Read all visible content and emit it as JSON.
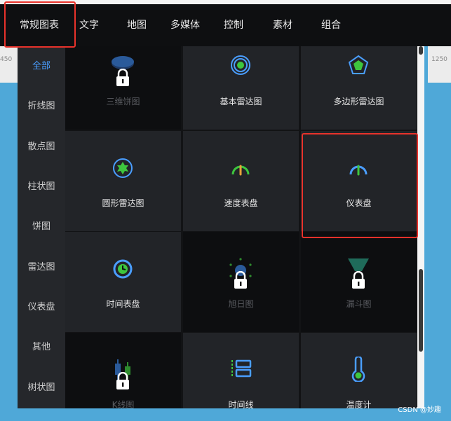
{
  "tabs": [
    {
      "label": "常规图表"
    },
    {
      "label": "文字"
    },
    {
      "label": "地图"
    },
    {
      "label": "多媒体"
    },
    {
      "label": "控制"
    },
    {
      "label": "素材"
    },
    {
      "label": "组合"
    }
  ],
  "ruler": {
    "left": "450",
    "right": "1250"
  },
  "sidebar": {
    "items": [
      {
        "label": "全部"
      },
      {
        "label": "折线图"
      },
      {
        "label": "散点图"
      },
      {
        "label": "柱状图"
      },
      {
        "label": "饼图"
      },
      {
        "label": "雷达图"
      },
      {
        "label": "仪表盘"
      },
      {
        "label": "其他"
      },
      {
        "label": "树状图"
      }
    ]
  },
  "cards": [
    {
      "label": "三维饼图",
      "icon": "pie-3d-icon",
      "locked": true
    },
    {
      "label": "基本雷达图",
      "icon": "radar-basic-icon",
      "locked": false
    },
    {
      "label": "多边形雷达图",
      "icon": "polygon-radar-icon",
      "locked": false
    },
    {
      "label": "圆形雷达图",
      "icon": "circle-radar-icon",
      "locked": false
    },
    {
      "label": "速度表盘",
      "icon": "speed-gauge-icon",
      "locked": false
    },
    {
      "label": "仪表盘",
      "icon": "gauge-icon",
      "locked": false
    },
    {
      "label": "时间表盘",
      "icon": "clock-gauge-icon",
      "locked": false
    },
    {
      "label": "旭日图",
      "icon": "sunburst-icon",
      "locked": true
    },
    {
      "label": "漏斗图",
      "icon": "funnel-icon",
      "locked": true
    },
    {
      "label": "K线图",
      "icon": "candlestick-icon",
      "locked": true
    },
    {
      "label": "时间线",
      "icon": "timeline-icon",
      "locked": false
    },
    {
      "label": "温度计",
      "icon": "thermometer-icon",
      "locked": false
    }
  ],
  "watermark": "CSDN @妙趣",
  "colors": {
    "accent": "#4a9eff",
    "green": "#3ec63e",
    "highlight": "#e8322b"
  }
}
